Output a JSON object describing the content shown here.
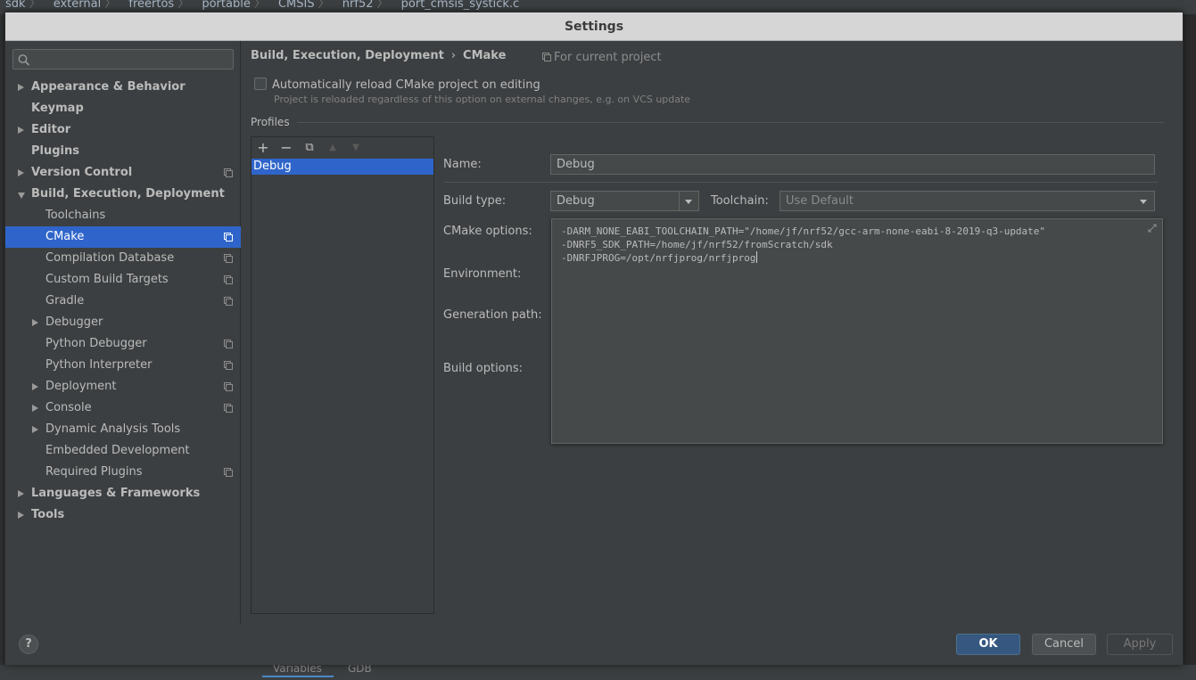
{
  "background": {
    "breadcrumbs": [
      "sdk",
      "external",
      "freertos",
      "portable",
      "CMSIS",
      "nrf52",
      "port_cmsis_systick.c"
    ],
    "bottom_tabs": [
      "Variables",
      "GDB"
    ]
  },
  "dialog": {
    "title": "Settings",
    "search": {
      "placeholder": "",
      "value": ""
    },
    "tree": [
      {
        "label": "Appearance & Behavior",
        "level": 0,
        "arrow": "right",
        "project": false
      },
      {
        "label": "Keymap",
        "level": 0,
        "arrow": "none",
        "project": false
      },
      {
        "label": "Editor",
        "level": 0,
        "arrow": "right",
        "project": false
      },
      {
        "label": "Plugins",
        "level": 0,
        "arrow": "none",
        "project": false
      },
      {
        "label": "Version Control",
        "level": 0,
        "arrow": "right",
        "project": true
      },
      {
        "label": "Build, Execution, Deployment",
        "level": 0,
        "arrow": "down",
        "project": false
      },
      {
        "label": "Toolchains",
        "level": 1,
        "arrow": "none",
        "project": false
      },
      {
        "label": "CMake",
        "level": 1,
        "arrow": "none",
        "project": true,
        "selected": true
      },
      {
        "label": "Compilation Database",
        "level": 1,
        "arrow": "none",
        "project": true
      },
      {
        "label": "Custom Build Targets",
        "level": 1,
        "arrow": "none",
        "project": true
      },
      {
        "label": "Gradle",
        "level": 1,
        "arrow": "none",
        "project": true
      },
      {
        "label": "Debugger",
        "level": 1,
        "arrow": "right",
        "project": false
      },
      {
        "label": "Python Debugger",
        "level": 1,
        "arrow": "none",
        "project": true
      },
      {
        "label": "Python Interpreter",
        "level": 1,
        "arrow": "none",
        "project": true
      },
      {
        "label": "Deployment",
        "level": 1,
        "arrow": "right",
        "project": true
      },
      {
        "label": "Console",
        "level": 1,
        "arrow": "right",
        "project": true
      },
      {
        "label": "Dynamic Analysis Tools",
        "level": 1,
        "arrow": "right",
        "project": false
      },
      {
        "label": "Embedded Development",
        "level": 1,
        "arrow": "none",
        "project": false
      },
      {
        "label": "Required Plugins",
        "level": 1,
        "arrow": "none",
        "project": true
      },
      {
        "label": "Languages & Frameworks",
        "level": 0,
        "arrow": "right",
        "project": false
      },
      {
        "label": "Tools",
        "level": 0,
        "arrow": "right",
        "project": false
      }
    ],
    "breadcrumb": {
      "parent": "Build, Execution, Deployment",
      "sep": "›",
      "current": "CMake"
    },
    "for_current_project": "For current project",
    "auto_reload": {
      "label": "Automatically reload CMake project on editing",
      "checked": false,
      "hint": "Project is reloaded regardless of this option on external changes, e.g. on VCS update"
    },
    "profiles": {
      "label": "Profiles",
      "toolbar": {
        "add": "+",
        "remove": "−",
        "copy": "⧉",
        "up": "▲",
        "down": "▼"
      },
      "items": [
        "Debug"
      ]
    },
    "form": {
      "name_label": "Name:",
      "name_value": "Debug",
      "build_type_label": "Build type:",
      "build_type_value": "Debug",
      "toolchain_label": "Toolchain:",
      "toolchain_value": "Use Default",
      "cmake_options_label": "CMake options:",
      "cmake_options_lines": [
        "-DARM_NONE_EABI_TOOLCHAIN_PATH=\"/home/jf/nrf52/gcc-arm-none-eabi-8-2019-q3-update\"",
        "-DNRF5_SDK_PATH=/home/jf/nrf52/fromScratch/sdk",
        "-DNRFJPROG=/opt/nrfjprog/nrfjprog"
      ],
      "environment_label": "Environment:",
      "generation_path_label": "Generation path:",
      "build_options_label": "Build options:"
    },
    "footer": {
      "help": "?",
      "ok": "OK",
      "cancel": "Cancel",
      "apply": "Apply"
    },
    "colors": {
      "selection": "#2f65ca",
      "ok_button": "#365880",
      "panel": "#3c3f41"
    }
  }
}
